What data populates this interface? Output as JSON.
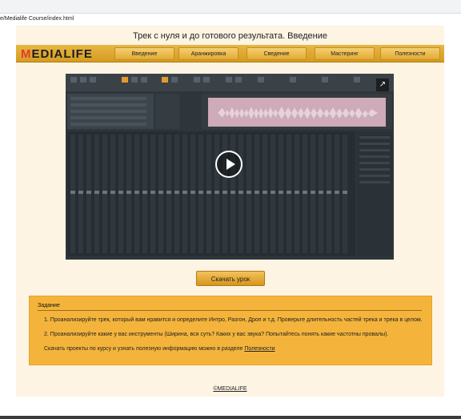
{
  "browser": {
    "url": "e/Medialife Course/index.html"
  },
  "page": {
    "title": "Трек с нуля и до готового результата. Введение"
  },
  "nav": {
    "logo_first": "M",
    "logo_rest": "EDIALIFE",
    "items": [
      {
        "label": "Введение"
      },
      {
        "label": "Аранжировка"
      },
      {
        "label": "Сведение"
      },
      {
        "label": "Мастеринг"
      },
      {
        "label": "Полезности"
      }
    ]
  },
  "video": {
    "expand_icon": "↗"
  },
  "download": {
    "label": "Скачать урок"
  },
  "task": {
    "title": "Задание",
    "items": [
      "1. Проанализируйте трек, который вам нравится и определите Интро, Разгон, Дроп и т.д. Проверьте длительность частей трека и трека в целом.",
      "2. Проанализируйте какие у вас инструменты (Ширина, вся суть? Каких у вас звука? Попытайтесь понять какие частотны провалы)."
    ],
    "note": "Скачать проекты по курсу и узнать полезную информацию можно в разделе",
    "note_link": "Полезности"
  },
  "footer": {
    "link": "©MEDIALIFE"
  },
  "colors": {
    "accent": "#e4aa33",
    "page_bg": "#fdf4e3",
    "task_bg": "#f4b43b",
    "logo_red": "#e23b2d"
  }
}
